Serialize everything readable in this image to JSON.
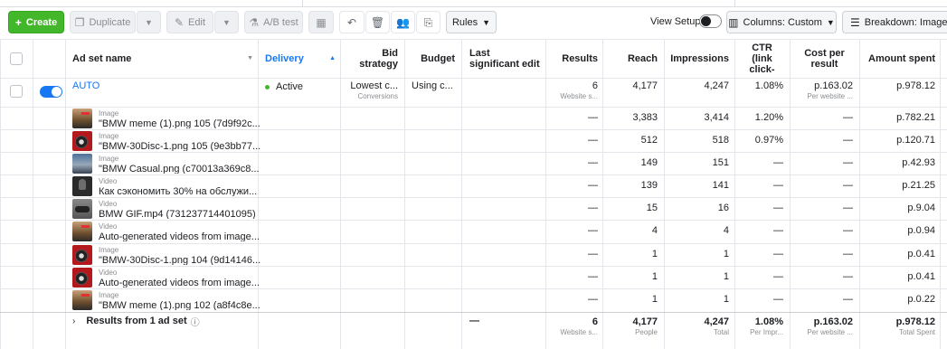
{
  "toolbar": {
    "create_label": "Create",
    "duplicate_label": "Duplicate",
    "edit_label": "Edit",
    "ab_test_label": "A/B test",
    "rules_label": "Rules",
    "view_setup_label": "View Setup",
    "columns_label": "Columns: Custom",
    "breakdown_label": "Breakdown: Image, vid"
  },
  "columns": {
    "name": "Ad set name",
    "delivery": "Delivery",
    "bid_strategy": "Bid strategy",
    "budget": "Budget",
    "last_edit": "Last significant edit",
    "results": "Results",
    "reach": "Reach",
    "impressions": "Impressions",
    "ctr": "CTR (link click-",
    "cost_per_result": "Cost per result",
    "amount_spent": "Amount spent"
  },
  "adset": {
    "name": "AUTO",
    "delivery": "Active",
    "bid_strategy": "Lowest c...",
    "bid_strategy_sub": "Conversions",
    "budget": "Using c...",
    "results": "6",
    "results_sub": "Website s...",
    "reach": "4,177",
    "impressions": "4,247",
    "ctr": "1.08%",
    "cost_per_result": "p.163.02",
    "cost_per_result_sub": "Per website ...",
    "amount_spent": "p.978.12"
  },
  "rows": [
    {
      "type": "Image",
      "name": "\"BMW meme (1).png 105 (7d9f92c...",
      "results": "—",
      "reach": "3,383",
      "impressions": "3,414",
      "ctr": "1.20%",
      "cost": "—",
      "spent": "p.782.21"
    },
    {
      "type": "Image",
      "name": "\"BMW-30Disc-1.png 105 (9e3bb77...",
      "results": "—",
      "reach": "512",
      "impressions": "518",
      "ctr": "0.97%",
      "cost": "—",
      "spent": "p.120.71"
    },
    {
      "type": "Image",
      "name": "\"BMW Casual.png (c70013a369c8...",
      "results": "—",
      "reach": "149",
      "impressions": "151",
      "ctr": "—",
      "cost": "—",
      "spent": "p.42.93"
    },
    {
      "type": "Video",
      "name": "Как сэкономить 30% на обслужи...",
      "results": "—",
      "reach": "139",
      "impressions": "141",
      "ctr": "—",
      "cost": "—",
      "spent": "p.21.25"
    },
    {
      "type": "Video",
      "name": "BMW GIF.mp4 (731237714401095)",
      "results": "—",
      "reach": "15",
      "impressions": "16",
      "ctr": "—",
      "cost": "—",
      "spent": "p.9.04"
    },
    {
      "type": "Video",
      "name": "Auto-generated videos from image...",
      "results": "—",
      "reach": "4",
      "impressions": "4",
      "ctr": "—",
      "cost": "—",
      "spent": "p.0.94"
    },
    {
      "type": "Image",
      "name": "\"BMW-30Disc-1.png 104 (9d14146...",
      "results": "—",
      "reach": "1",
      "impressions": "1",
      "ctr": "—",
      "cost": "—",
      "spent": "p.0.41"
    },
    {
      "type": "Video",
      "name": "Auto-generated videos from image...",
      "results": "—",
      "reach": "1",
      "impressions": "1",
      "ctr": "—",
      "cost": "—",
      "spent": "p.0.41"
    },
    {
      "type": "Image",
      "name": "\"BMW meme (1).png 102 (a8f4c8e...",
      "results": "—",
      "reach": "1",
      "impressions": "1",
      "ctr": "—",
      "cost": "—",
      "spent": "p.0.22"
    }
  ],
  "footer": {
    "label": "Results from 1 ad set",
    "last_edit": "—",
    "results": "6",
    "results_sub": "Website s...",
    "reach": "4,177",
    "reach_sub": "People",
    "impressions": "4,247",
    "impressions_sub": "Total",
    "ctr": "1.08%",
    "ctr_sub": "Per Impr...",
    "cost_per_result": "p.163.02",
    "cost_per_result_sub": "Per website ...",
    "amount_spent": "p.978.12",
    "amount_spent_sub": "Total Spent"
  }
}
